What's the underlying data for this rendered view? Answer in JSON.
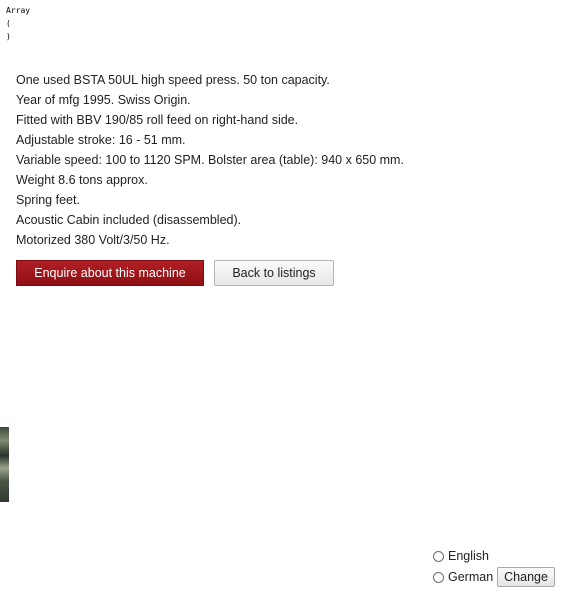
{
  "debug_output": {
    "lines": [
      "Array",
      "(",
      ")"
    ]
  },
  "listing": {
    "description_lines": [
      "One used BSTA 50UL high speed press. 50 ton capacity.",
      "Year of mfg 1995. Swiss Origin.",
      "Fitted with BBV 190/85 roll feed on right-hand side.",
      "Adjustable stroke: 16 - 51 mm.",
      "Variable speed: 100 to 1120 SPM. Bolster area (table): 940 x 650 mm.",
      "Weight 8.6 tons approx.",
      "Spring feet.",
      "Acoustic Cabin included (disassembled).",
      "Motorized 380 Volt/3/50 Hz."
    ],
    "enquire_label": "Enquire about this machine",
    "back_label": "Back to listings"
  },
  "language": {
    "options": [
      "English",
      "German"
    ],
    "change_label": "Change"
  },
  "colors": {
    "enquire_button": "#9e171c",
    "text": "#222222"
  }
}
